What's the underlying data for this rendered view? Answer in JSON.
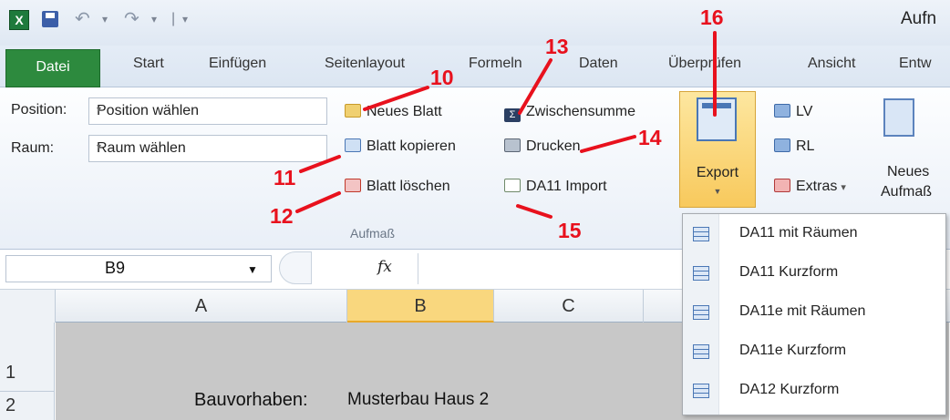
{
  "app": {
    "title_fragment": "Aufn",
    "logo_letter": "X"
  },
  "tabs": {
    "file": "Datei",
    "items": [
      "Start",
      "Einfügen",
      "Seitenlayout",
      "Formeln",
      "Daten",
      "Überprüfen",
      "Ansicht",
      "Entw"
    ]
  },
  "ribbon": {
    "position_label": "Position:",
    "position_value": "Position wählen",
    "raum_label": "Raum:",
    "raum_value": "Raum wählen",
    "neues_blatt": "Neues Blatt",
    "blatt_kopieren": "Blatt kopieren",
    "blatt_loeschen": "Blatt löschen",
    "zwischensumme": "Zwischensumme",
    "drucken": "Drucken",
    "da11_import": "DA11 Import",
    "group_label": "Aufmaß",
    "export": "Export",
    "lv": "LV",
    "rl": "RL",
    "extras": "Extras",
    "neues": "Neues",
    "aufmass": "Aufmaß"
  },
  "formula_bar": {
    "name_box": "B9",
    "fx": "fx"
  },
  "grid": {
    "columns": [
      "A",
      "B",
      "C"
    ],
    "selected_column": "B",
    "rows": [
      "1",
      "2"
    ],
    "cell_label": "Bauvorhaben:",
    "cell_value": "Musterbau Haus 2"
  },
  "export_menu": {
    "items": [
      "DA11 mit Räumen",
      "DA11 Kurzform",
      "DA11e mit Räumen",
      "DA11e Kurzform",
      "DA12 Kurzform"
    ]
  },
  "annotations": [
    "10",
    "11",
    "12",
    "13",
    "14",
    "15",
    "16"
  ],
  "colors": {
    "annotation": "#e8111d",
    "file_tab": "#2d8a3e",
    "export_highlight": "#f8c95c"
  }
}
